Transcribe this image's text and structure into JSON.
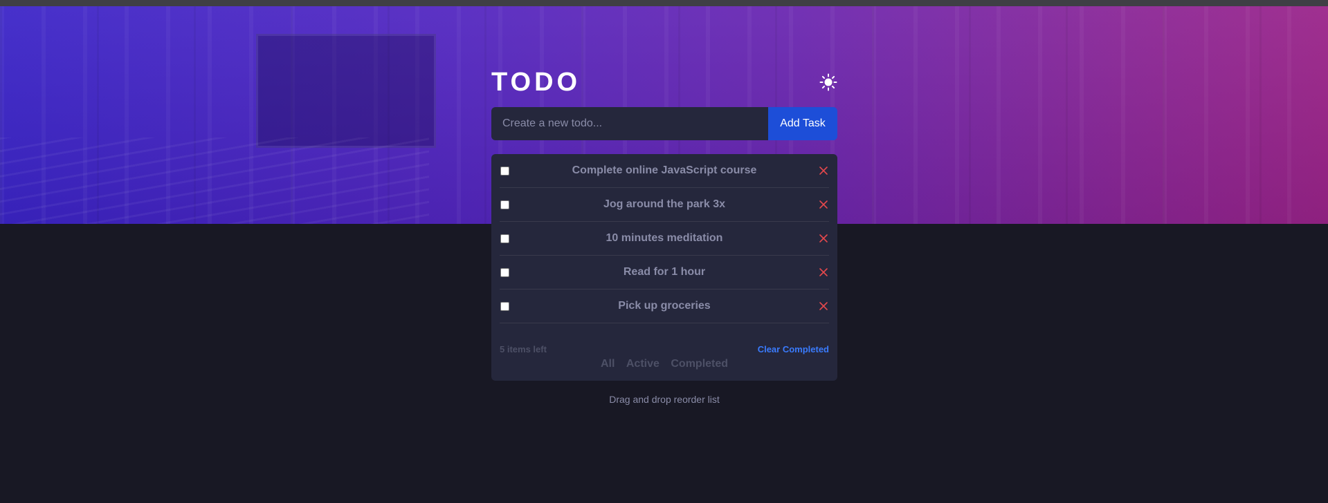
{
  "app": {
    "title": "TODO"
  },
  "header": {
    "theme_icon": "sun-icon"
  },
  "new_todo": {
    "placeholder": "Create a new todo...",
    "add_label": "Add Task"
  },
  "todos": [
    {
      "text": "Complete online JavaScript course",
      "completed": false
    },
    {
      "text": "Jog around the park 3x",
      "completed": false
    },
    {
      "text": "10 minutes meditation",
      "completed": false
    },
    {
      "text": "Read for 1 hour",
      "completed": false
    },
    {
      "text": "Pick up groceries",
      "completed": false
    }
  ],
  "footer": {
    "items_left": "5 items left",
    "clear_label": "Clear Completed",
    "filters": [
      "All",
      "Active",
      "Completed"
    ]
  },
  "hint": "Drag and drop reorder list",
  "colors": {
    "accent": "#3a7bfd",
    "add_button": "#1d4ed8",
    "delete": "#e5484d",
    "card": "#25273c",
    "background": "#181824"
  }
}
